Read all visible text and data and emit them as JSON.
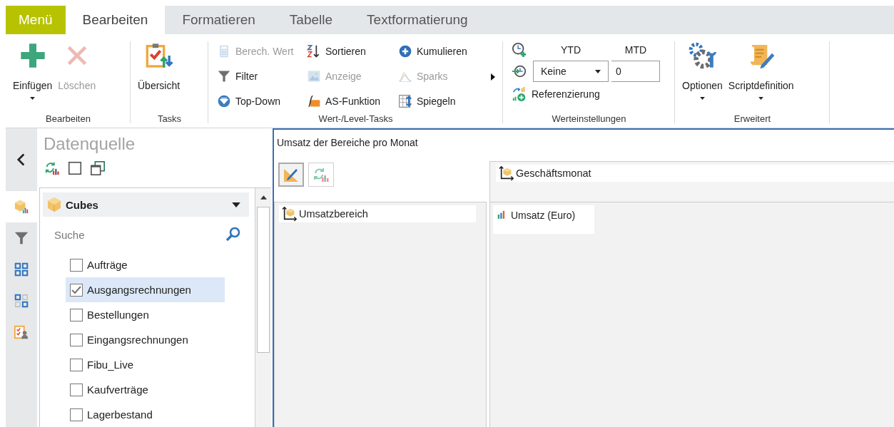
{
  "tabs": [
    {
      "label": "Menü",
      "kind": "menu",
      "selected": false
    },
    {
      "label": "Bearbeiten",
      "kind": "tab",
      "selected": true
    },
    {
      "label": "Formatieren",
      "kind": "tab",
      "selected": false
    },
    {
      "label": "Tabelle",
      "kind": "tab",
      "selected": false
    },
    {
      "label": "Textformatierung",
      "kind": "tab",
      "selected": false
    }
  ],
  "ribbon": {
    "groups": [
      {
        "label": "Bearbeiten",
        "kind": "large",
        "items": [
          {
            "label": "Einfügen",
            "disabled": false,
            "dropdown": true
          },
          {
            "label": "Löschen",
            "disabled": true,
            "dropdown": false
          }
        ]
      },
      {
        "label": "Tasks",
        "kind": "large",
        "items": [
          {
            "label": "Übersicht",
            "disabled": false,
            "dropdown": false
          }
        ]
      },
      {
        "label": "Wert-/Level-Tasks",
        "kind": "grid",
        "more": true,
        "items": [
          {
            "label": "Berech. Wert",
            "disabled": true
          },
          {
            "label": "Sortieren",
            "disabled": false
          },
          {
            "label": "Kumulieren",
            "disabled": false
          },
          {
            "label": "Filter",
            "disabled": false
          },
          {
            "label": "Anzeige",
            "disabled": true
          },
          {
            "label": "Sparks",
            "disabled": true
          },
          {
            "label": "Top-Down",
            "disabled": false
          },
          {
            "label": "AS-Funktion",
            "disabled": false
          },
          {
            "label": "Spiegeln",
            "disabled": false
          }
        ]
      },
      {
        "label": "Werteinstellungen",
        "kind": "values",
        "ytd": "YTD",
        "mtd": "MTD",
        "period": {
          "value": "Keine"
        },
        "offset": {
          "value": "0"
        },
        "reference": {
          "label": "Referenzierung"
        }
      },
      {
        "label": "Erweitert",
        "kind": "large",
        "items": [
          {
            "label": "Optionen",
            "disabled": false,
            "dropdown": true
          },
          {
            "label": "Scriptdefinition",
            "disabled": false,
            "dropdown": true
          }
        ]
      }
    ]
  },
  "side_strip": [
    {
      "selected": true
    },
    {
      "selected": false
    },
    {
      "selected": false
    },
    {
      "selected": false
    },
    {
      "selected": false
    }
  ],
  "datasource": {
    "title": "Datenquelle",
    "dropdown": {
      "value": "Cubes"
    },
    "search": {
      "placeholder": "Suche"
    },
    "cubes": [
      {
        "label": "Aufträge",
        "checked": false,
        "selected": false
      },
      {
        "label": "Ausgangsrechnungen",
        "checked": true,
        "selected": true
      },
      {
        "label": "Bestellungen",
        "checked": false,
        "selected": false
      },
      {
        "label": "Eingangsrechnungen",
        "checked": false,
        "selected": false
      },
      {
        "label": "Fibu_Live",
        "checked": false,
        "selected": false
      },
      {
        "label": "Kaufverträge",
        "checked": false,
        "selected": false
      },
      {
        "label": "Lagerbestand",
        "checked": false,
        "selected": false
      }
    ]
  },
  "report": {
    "title": "Umsatz der Bereiche pro Monat",
    "tools": [
      {
        "pressed": true,
        "disabled": false
      },
      {
        "pressed": false,
        "disabled": true
      }
    ],
    "column_field": "Geschäftsmonat",
    "row_field": "Umsatzbereich",
    "measure": "Umsatz (Euro)"
  }
}
